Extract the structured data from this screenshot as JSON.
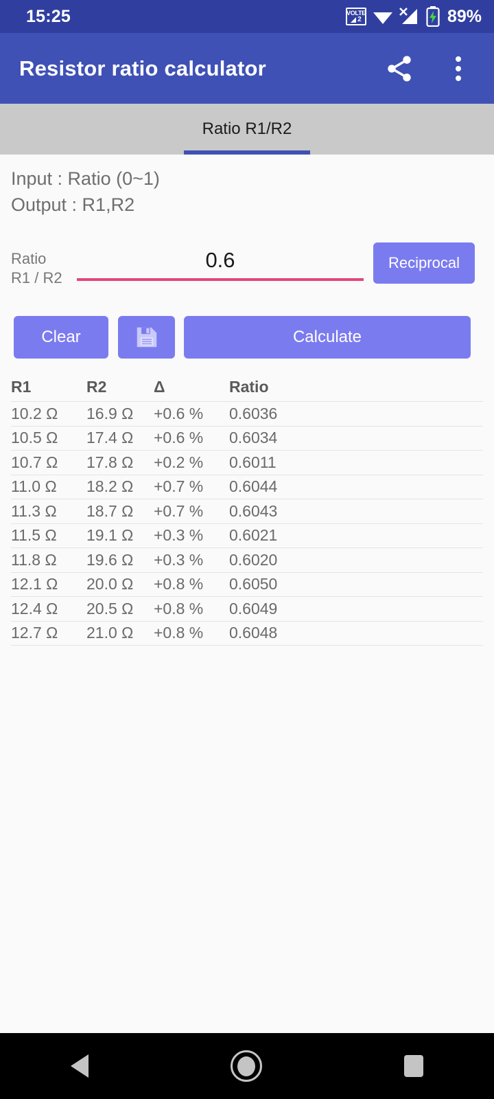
{
  "statusbar": {
    "time": "15:25",
    "volte_label": "VOLTE",
    "volte_sim": "2",
    "wifi_icon": "wifi-icon",
    "signal_icon": "signal-no-service-icon",
    "battery_icon": "battery-charging-icon",
    "battery": "89%"
  },
  "appbar": {
    "title": "Resistor ratio calculator",
    "share_icon": "share-icon",
    "overflow_icon": "overflow-menu-icon"
  },
  "tabs": [
    {
      "label": "Ratio R1/R2",
      "active": true
    }
  ],
  "info": {
    "line1": "Input : Ratio (0~1)",
    "line2": "Output : R1,R2"
  },
  "input": {
    "label_line1": "Ratio",
    "label_line2": "R1 / R2",
    "value": "0.6",
    "placeholder": "0.6",
    "reciprocal_label": "Reciprocal"
  },
  "actions": {
    "clear_label": "Clear",
    "save_icon": "save-floppy-icon",
    "calculate_label": "Calculate"
  },
  "table": {
    "headers": [
      "R1",
      "R2",
      "Δ",
      "Ratio"
    ],
    "rows": [
      {
        "r1": "10.2 Ω",
        "r2": "16.9 Ω",
        "delta": "+0.6 %",
        "ratio": "0.6036"
      },
      {
        "r1": "10.5 Ω",
        "r2": "17.4 Ω",
        "delta": "+0.6 %",
        "ratio": "0.6034"
      },
      {
        "r1": "10.7 Ω",
        "r2": "17.8 Ω",
        "delta": "+0.2 %",
        "ratio": "0.6011"
      },
      {
        "r1": "11.0 Ω",
        "r2": "18.2 Ω",
        "delta": "+0.7 %",
        "ratio": "0.6044"
      },
      {
        "r1": "11.3 Ω",
        "r2": "18.7 Ω",
        "delta": "+0.7 %",
        "ratio": "0.6043"
      },
      {
        "r1": "11.5 Ω",
        "r2": "19.1 Ω",
        "delta": "+0.3 %",
        "ratio": "0.6021"
      },
      {
        "r1": "11.8 Ω",
        "r2": "19.6 Ω",
        "delta": "+0.3 %",
        "ratio": "0.6020"
      },
      {
        "r1": "12.1 Ω",
        "r2": "20.0 Ω",
        "delta": "+0.8 %",
        "ratio": "0.6050"
      },
      {
        "r1": "12.4 Ω",
        "r2": "20.5 Ω",
        "delta": "+0.8 %",
        "ratio": "0.6049"
      },
      {
        "r1": "12.7 Ω",
        "r2": "21.0 Ω",
        "delta": "+0.8 %",
        "ratio": "0.6048"
      }
    ]
  },
  "navbar": {
    "back_icon": "back-triangle-icon",
    "home_icon": "home-circle-icon",
    "recents_icon": "recents-square-icon"
  },
  "colors": {
    "statusbar": "#303f9f",
    "appbar": "#3f51b5",
    "tabbar": "#c9c9c9",
    "tab_indicator": "#3f51b5",
    "button": "#7b7bf0",
    "input_underline": "#e5457d",
    "page_background": "#fafafa"
  }
}
